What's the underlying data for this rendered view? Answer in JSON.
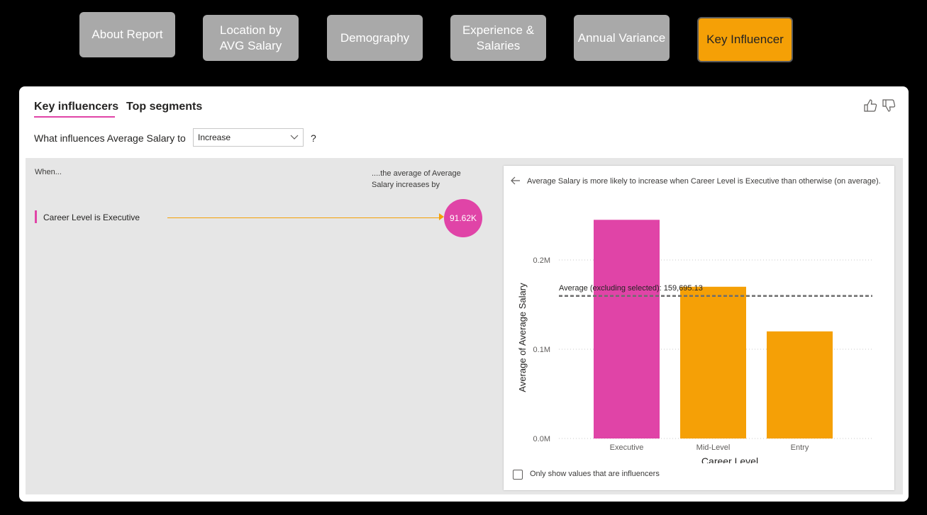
{
  "nav": {
    "buttons": [
      {
        "label": "About Report"
      },
      {
        "label": "Location by\nAVG Salary"
      },
      {
        "label": "Demography"
      },
      {
        "label": "Experience &\nSalaries"
      },
      {
        "label": "Annual Variance"
      },
      {
        "label": "Key Influencer",
        "active": true
      }
    ]
  },
  "visual": {
    "tabs": [
      "Key influencers",
      "Top segments"
    ],
    "question": "What influences Average Salary to",
    "dropdown_value": "Increase",
    "question_mark": "?",
    "when_label": "When...",
    "increase_label": "....the average of Average Salary increases by",
    "influencers": [
      {
        "label": "Career Level is Executive",
        "value_label": "91.62K"
      }
    ],
    "detail_text": "Average Salary is more likely to increase when Career Level is Executive than otherwise (on average).",
    "checkbox_label": "Only show values that are influencers"
  },
  "chart_data": {
    "type": "bar",
    "categories": [
      "Executive",
      "Mid-Level",
      "Entry"
    ],
    "values": [
      245000,
      170000,
      120000
    ],
    "colors": [
      "#e044a7",
      "#f5a006",
      "#f5a006"
    ],
    "xlabel": "Career Level",
    "ylabel": "Average of Average Salary",
    "yticks": [
      "0.0M",
      "0.1M",
      "0.2M"
    ],
    "ytick_values": [
      0,
      100000,
      200000
    ],
    "ylim": [
      0,
      250000
    ],
    "reference_line": {
      "value": 159695.13,
      "label": "Average (excluding selected): 159,695.13"
    }
  },
  "colors": {
    "accent": "#e044a7",
    "highlight": "#f5a006"
  }
}
